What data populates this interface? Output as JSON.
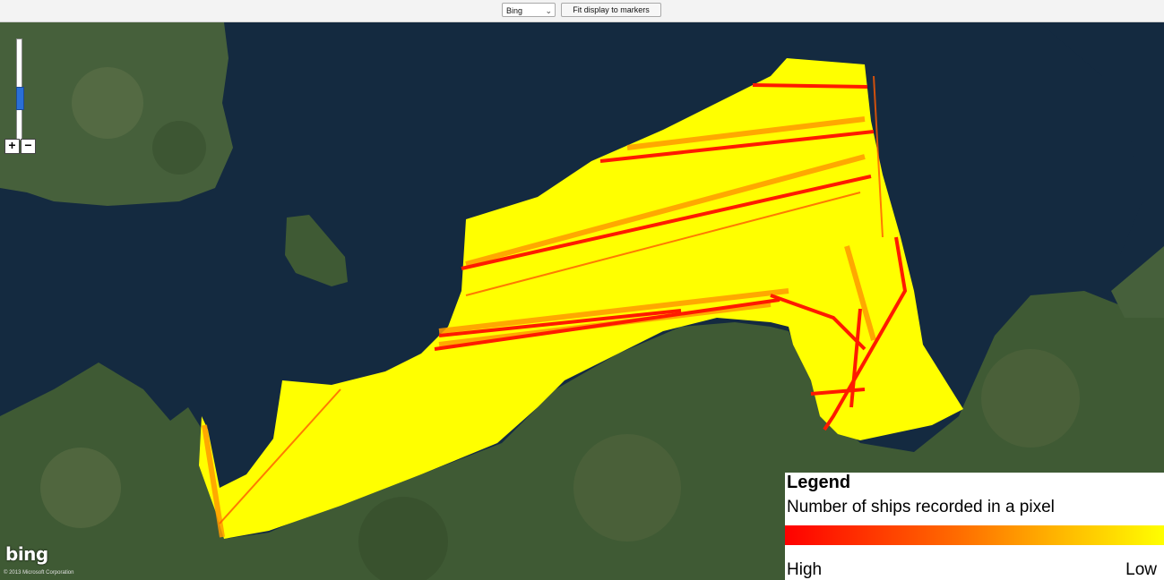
{
  "toolbar": {
    "map_source_select": "Bing",
    "fit_button_label": "Fit display to markers"
  },
  "map": {
    "provider_logo": "bing",
    "copyright": "© 2013 Microsoft Corporation",
    "colors": {
      "water": "#142a40",
      "land": "#3f5a34",
      "density_low": "#ffff00",
      "density_high": "#ff0000"
    }
  },
  "legend": {
    "title": "Legend",
    "subtitle": "Number of ships recorded in a pixel",
    "high_label": "High",
    "low_label": "Low"
  },
  "icons": [
    "zoom-slider",
    "zoom-in-icon",
    "zoom-out-icon",
    "chevron-down-icon"
  ]
}
